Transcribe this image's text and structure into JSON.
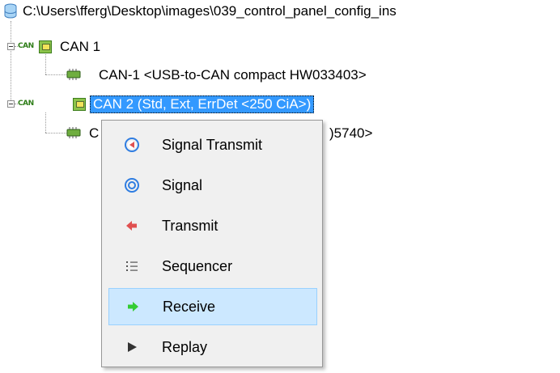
{
  "tree": {
    "root_path": "C:\\Users\\fferg\\Desktop\\images\\039_control_panel_config_ins",
    "can_logo_text": "CAN",
    "nodes": [
      {
        "label": "CAN 1",
        "expanded": true,
        "selected": false
      },
      {
        "label": "CAN 2  (Std, Ext, ErrDet <250 CiA>)",
        "expanded": true,
        "selected": true
      }
    ],
    "children": [
      {
        "label": "CAN-1  <USB-to-CAN compact HW033403>"
      },
      {
        "label_prefix": "C",
        "label_suffix": ")5740>"
      }
    ]
  },
  "context_menu": {
    "items": [
      {
        "label": "Signal Transmit",
        "icon": "signal-transmit-icon",
        "highlighted": false
      },
      {
        "label": "Signal",
        "icon": "signal-icon",
        "highlighted": false
      },
      {
        "label": "Transmit",
        "icon": "transmit-arrow-icon",
        "highlighted": false
      },
      {
        "label": "Sequencer",
        "icon": "sequencer-list-icon",
        "highlighted": false
      },
      {
        "label": "Receive",
        "icon": "receive-arrow-icon",
        "highlighted": true
      },
      {
        "label": "Replay",
        "icon": "replay-play-icon",
        "highlighted": false
      }
    ]
  },
  "colors": {
    "selection_bg": "#3399ff",
    "menu_bg": "#f0f0f0",
    "menu_hover_bg": "#cce8ff",
    "menu_hover_border": "#99d1ff",
    "can_green": "#2e7d17",
    "transmit_red": "#e05050",
    "signal_blue": "#2f7de1",
    "receive_green": "#33cc33"
  }
}
